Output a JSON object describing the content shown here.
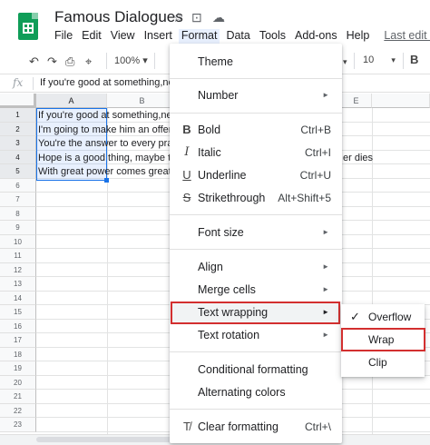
{
  "doc_title": "Famous Dialogues",
  "menubar": [
    "File",
    "Edit",
    "View",
    "Insert",
    "Format",
    "Data",
    "Tools",
    "Add-ons",
    "Help"
  ],
  "last_edit": "Last edit was",
  "toolbar": {
    "zoom": "100%",
    "font_size": "10",
    "bold": "B"
  },
  "formula_text": "If you're good at something,never",
  "columns": [
    "A",
    "B",
    "",
    "",
    "E"
  ],
  "rows": [
    "1",
    "2",
    "3",
    "4",
    "5",
    "6",
    "7",
    "8",
    "9",
    "10",
    "11",
    "12",
    "13",
    "14",
    "15",
    "16",
    "17",
    "18",
    "19",
    "20",
    "21",
    "22",
    "23"
  ],
  "cells": [
    "If you're good at something,never",
    "I'm going to make him an offer h",
    "You're the answer to every pray",
    "Hope is a good thing, maybe th",
    "With great power comes great r"
  ],
  "cell_tail_row4": "er dies",
  "format_menu": {
    "theme": "Theme",
    "number": "Number",
    "bold": {
      "label": "Bold",
      "shortcut": "Ctrl+B"
    },
    "italic": {
      "label": "Italic",
      "shortcut": "Ctrl+I"
    },
    "underline": {
      "label": "Underline",
      "shortcut": "Ctrl+U"
    },
    "strikethrough": {
      "label": "Strikethrough",
      "shortcut": "Alt+Shift+5"
    },
    "font_size": "Font size",
    "align": "Align",
    "merge_cells": "Merge cells",
    "text_wrapping": "Text wrapping",
    "text_rotation": "Text rotation",
    "conditional_formatting": "Conditional formatting",
    "alternating_colors": "Alternating colors",
    "clear_formatting": {
      "label": "Clear formatting",
      "shortcut": "Ctrl+\\"
    }
  },
  "wrap_submenu": [
    "Overflow",
    "Wrap",
    "Clip"
  ],
  "colors": {
    "highlight_box": "#d32f2f",
    "selection": "#1a73e8",
    "sheets_green": "#0f9d58"
  }
}
